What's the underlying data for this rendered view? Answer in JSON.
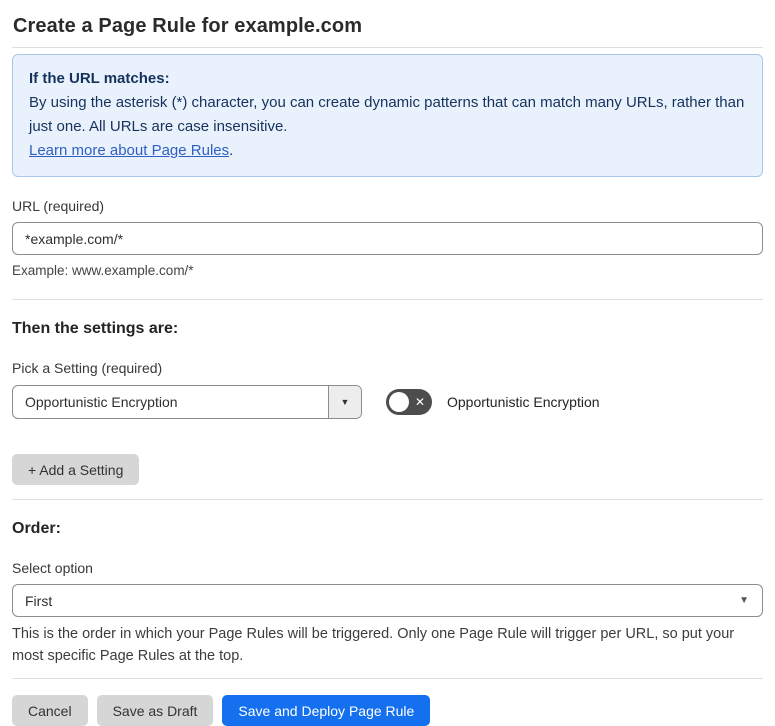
{
  "page": {
    "title": "Create a Page Rule for example.com"
  },
  "info_box": {
    "heading": "If the URL matches:",
    "body": "By using the asterisk (*) character, you can create dynamic patterns that can match many URLs, rather than just one. All URLs are case insensitive.",
    "link_label": "Learn more about Page Rules",
    "link_suffix": "."
  },
  "url_section": {
    "label": "URL (required)",
    "value": "*example.com/*",
    "helper": "Example: www.example.com/*"
  },
  "settings_section": {
    "heading": "Then the settings are:",
    "picker_label": "Pick a Setting (required)",
    "selected_setting": "Opportunistic Encryption",
    "toggle_state": "off",
    "toggle_label": "Opportunistic Encryption",
    "add_setting_label": "+ Add a Setting"
  },
  "order_section": {
    "heading": "Order:",
    "select_label": "Select option",
    "selected_option": "First",
    "helper": "This is the order in which your Page Rules will be triggered. Only one Page Rule will trigger per URL, so put your most specific Page Rules at the top."
  },
  "actions": {
    "cancel_label": "Cancel",
    "save_draft_label": "Save as Draft",
    "save_deploy_label": "Save and Deploy Page Rule"
  },
  "icons": {
    "dropdown_arrow": "▼",
    "toggle_x": "✕"
  },
  "colors": {
    "primary_blue": "#1570ef",
    "info_bg": "#e9f2fc",
    "info_border": "#a9c7ea",
    "info_text": "#16325c",
    "link_blue": "#2f5fc4",
    "toggle_off_bg": "#4d4d4d",
    "button_gray": "#d6d6d6"
  }
}
